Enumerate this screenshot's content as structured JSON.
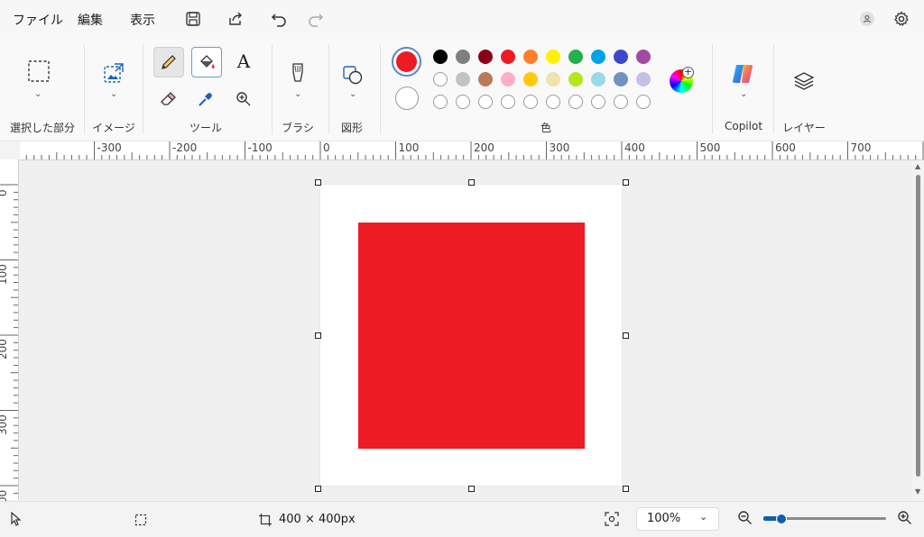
{
  "menu": {
    "file": "ファイル",
    "edit": "編集",
    "view": "表示"
  },
  "groups": {
    "selection": "選択した部分",
    "image": "イメージ",
    "tools": "ツール",
    "brush": "ブラシ",
    "shapes": "図形",
    "colors": "色",
    "copilot": "Copilot",
    "layers": "レイヤー"
  },
  "colors": {
    "primary": "#ed1c24",
    "secondary": "#ffffff",
    "palette_row1": [
      "#000000",
      "#7f7f7f",
      "#880015",
      "#ed1c24",
      "#ff7f27",
      "#fff200",
      "#22b14c",
      "#00a2e8",
      "#3f48cc",
      "#a349a4"
    ],
    "palette_row2": [
      "#ffffff",
      "#c3c3c3",
      "#b97a57",
      "#ffaec9",
      "#ffc90e",
      "#efe4b0",
      "#b5e61d",
      "#99d9ea",
      "#7092be",
      "#c8bfe7"
    ],
    "palette_row3": [
      "",
      "",
      "",
      "",
      "",
      "",
      "",
      "",
      "",
      ""
    ]
  },
  "ruler": {
    "h": [
      "-300",
      "-200",
      "-100",
      "0",
      "100",
      "200",
      "300",
      "400",
      "500",
      "600",
      "700"
    ],
    "v": [
      "0",
      "100",
      "200",
      "300",
      "00"
    ]
  },
  "status": {
    "canvas_size": "400 × 400px",
    "zoom": "100%",
    "zoom_level_fraction": 0.15
  }
}
